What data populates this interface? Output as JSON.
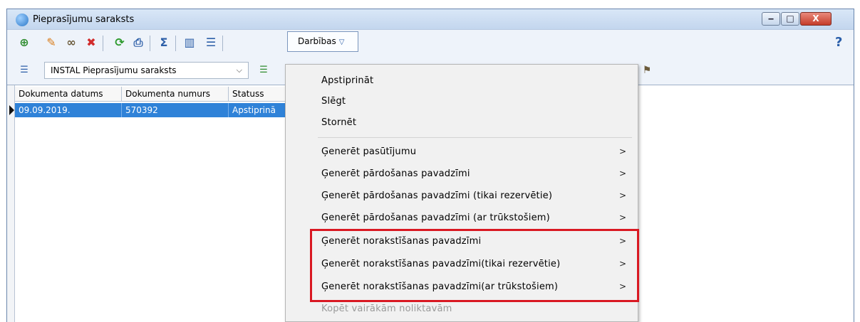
{
  "window": {
    "title": "Pieprasījumu saraksts",
    "min_label": "‒",
    "max_label": "□",
    "close_label": "X"
  },
  "toolbar": {
    "actions_label": "Darbības",
    "help_label": "?",
    "icons": [
      "add-icon",
      "edit-icon",
      "view-icon",
      "delete-icon",
      "refresh-icon",
      "print-icon",
      "sum-icon",
      "columns-icon",
      "tree-icon"
    ]
  },
  "filter": {
    "list_name": "INSTAL Pieprasījumu saraksts"
  },
  "grid": {
    "columns": [
      "Dokumenta datums",
      "Dokumenta numurs",
      "Statuss"
    ],
    "rows": [
      [
        "09.09.2019.",
        "570392",
        "Apstiprinā"
      ]
    ]
  },
  "menu": {
    "items": [
      {
        "label": "Apstiprināt",
        "submenu": false,
        "enabled": true
      },
      {
        "label": "Slēgt",
        "submenu": false,
        "enabled": true
      },
      {
        "label": "Stornēt",
        "submenu": false,
        "enabled": true
      },
      {
        "label": "Ģenerēt pasūtījumu",
        "submenu": true,
        "enabled": true
      },
      {
        "label": "Ģenerēt pārdošanas pavadzīmi",
        "submenu": true,
        "enabled": true
      },
      {
        "label": "Ģenerēt pārdošanas pavadzīmi (tikai rezervētie)",
        "submenu": true,
        "enabled": true
      },
      {
        "label": "Ģenerēt pārdošanas pavadzīmi (ar trūkstošiem)",
        "submenu": true,
        "enabled": true
      },
      {
        "label": "Ģenerēt norakstīšanas pavadzīmi",
        "submenu": true,
        "enabled": true
      },
      {
        "label": "Ģenerēt norakstīšanas pavadzīmi(tikai rezervētie)",
        "submenu": true,
        "enabled": true
      },
      {
        "label": "Ģenerēt norakstīšanas pavadzīmi(ar trūkstošiem)",
        "submenu": true,
        "enabled": true
      },
      {
        "label": "Kopēt vairākām noliktavām",
        "submenu": false,
        "enabled": false
      }
    ],
    "arrow_glyph": ">",
    "highlight_color": "#d91822"
  },
  "colors": {
    "selection": "#2f82d8",
    "window_frame": "#c8daf0"
  }
}
